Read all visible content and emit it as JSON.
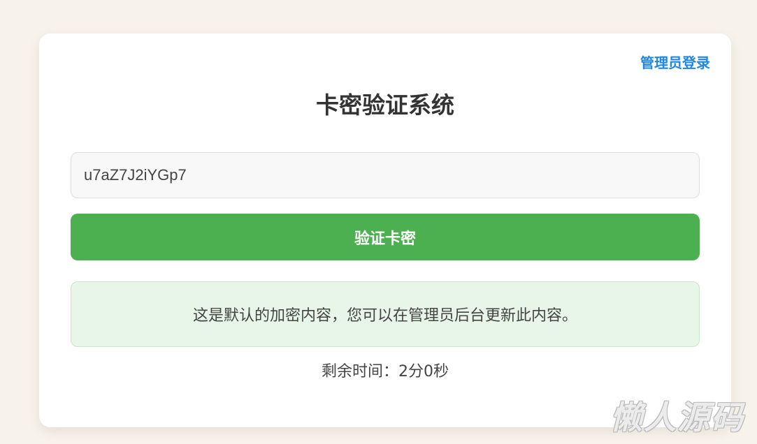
{
  "header": {
    "admin_link_label": "管理员登录",
    "title": "卡密验证系统"
  },
  "form": {
    "key_value": "u7aZ7J2iYGp7",
    "verify_button_label": "验证卡密"
  },
  "result": {
    "content_text": "这是默认的加密内容，您可以在管理员后台更新此内容。",
    "timer_text": "剩余时间：2分0秒"
  },
  "watermark": {
    "text": "懒人源码"
  },
  "colors": {
    "accent_green": "#4caf50",
    "link_blue": "#1e87e6",
    "success_bg": "#e8f5e9",
    "page_bg": "#f7f2ea"
  }
}
